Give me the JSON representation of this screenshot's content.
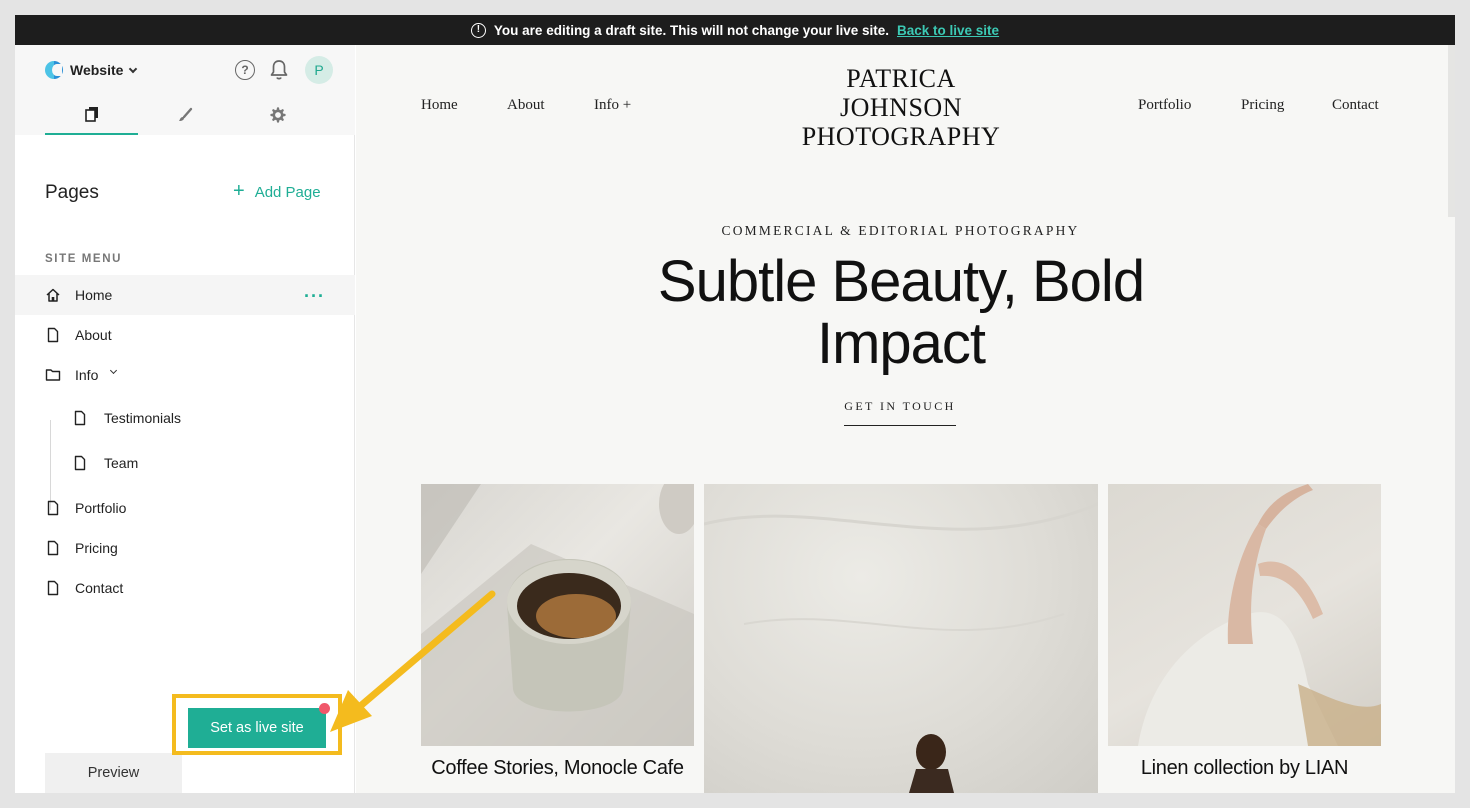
{
  "banner": {
    "message": "You are editing a draft site. This will not change your live site.",
    "link_label": "Back to live site"
  },
  "sidebar": {
    "site_name": "Website",
    "avatar_initial": "P",
    "pages_title": "Pages",
    "add_page_label": "Add Page",
    "site_menu_label": "SITE MENU",
    "items": [
      {
        "label": "Home",
        "icon": "home-icon"
      },
      {
        "label": "About",
        "icon": "page-icon"
      },
      {
        "label": "Info",
        "icon": "folder-icon"
      },
      {
        "label": "Testimonials",
        "icon": "page-icon"
      },
      {
        "label": "Team",
        "icon": "page-icon"
      },
      {
        "label": "Portfolio",
        "icon": "page-icon"
      },
      {
        "label": "Pricing",
        "icon": "page-icon"
      },
      {
        "label": "Contact",
        "icon": "page-icon"
      }
    ],
    "preview_label": "Preview",
    "set_live_label": "Set as live site"
  },
  "site": {
    "nav_left": [
      "Home",
      "About",
      "Info +"
    ],
    "nav_right": [
      "Portfolio",
      "Pricing",
      "Contact"
    ],
    "brand_lines": [
      "PATRICA",
      "JOHNSON",
      "PHOTOGRAPHY"
    ],
    "tagline": "COMMERCIAL & EDITORIAL PHOTOGRAPHY",
    "hero_title": "Subtle Beauty, Bold Impact",
    "cta_label": "GET IN TOUCH",
    "captions": [
      "Coffee Stories, Monocle Cafe",
      "Linen collection by LIAN"
    ]
  },
  "colors": {
    "accent": "#1fae95",
    "highlight": "#f4bb1e",
    "notification_dot": "#f0576a",
    "banner_bg": "#1d1d1d"
  }
}
